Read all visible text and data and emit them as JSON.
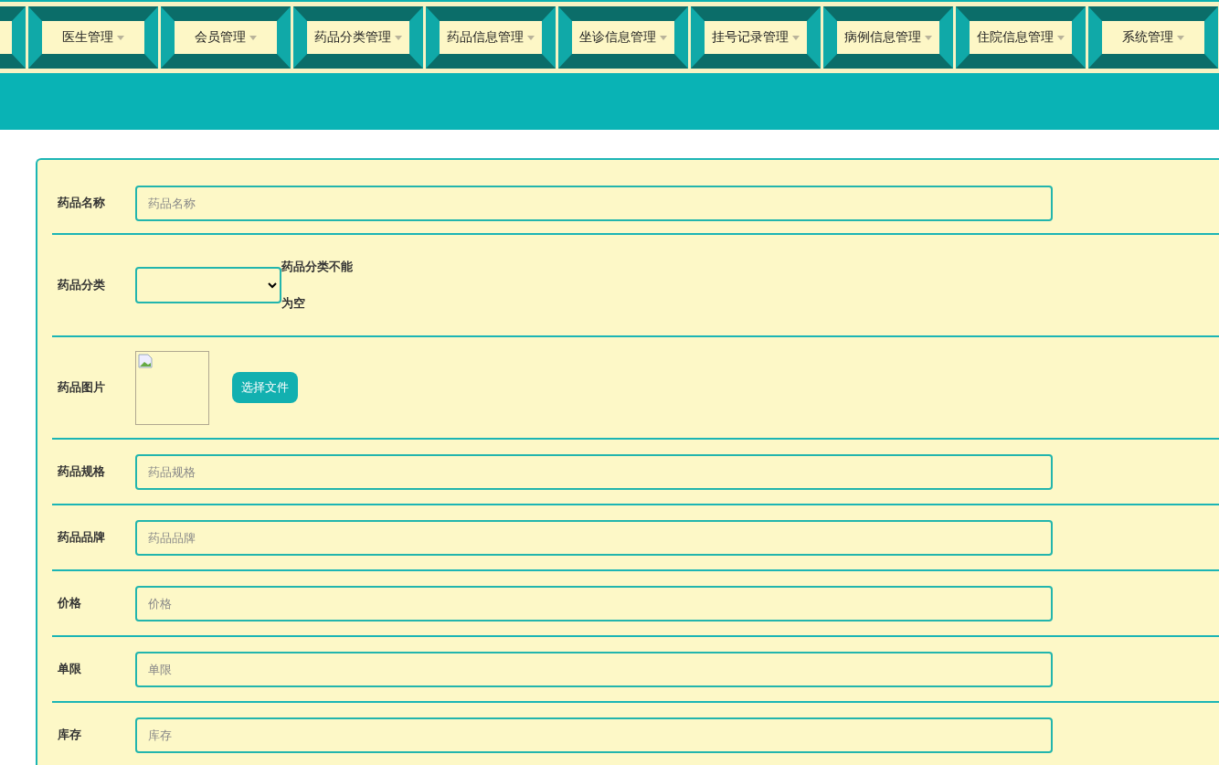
{
  "nav": [
    {
      "label": "医生管理"
    },
    {
      "label": "会员管理"
    },
    {
      "label": "药品分类管理"
    },
    {
      "label": "药品信息管理"
    },
    {
      "label": "坐诊信息管理"
    },
    {
      "label": "挂号记录管理"
    },
    {
      "label": "病例信息管理"
    },
    {
      "label": "住院信息管理"
    },
    {
      "label": "系统管理"
    }
  ],
  "form": {
    "fields": [
      {
        "kind": "text",
        "label": "药品名称",
        "placeholder": "药品名称"
      },
      {
        "kind": "select",
        "label": "药品分类",
        "error": "药品分类不能为空"
      },
      {
        "kind": "image",
        "label": "药品图片",
        "button": "选择文件"
      },
      {
        "kind": "text",
        "label": "药品规格",
        "placeholder": "药品规格"
      },
      {
        "kind": "text",
        "label": "药品品牌",
        "placeholder": "药品品牌"
      },
      {
        "kind": "text",
        "label": "价格",
        "placeholder": "价格"
      },
      {
        "kind": "text",
        "label": "单限",
        "placeholder": "单限"
      },
      {
        "kind": "text",
        "label": "库存",
        "placeholder": "库存"
      }
    ]
  }
}
